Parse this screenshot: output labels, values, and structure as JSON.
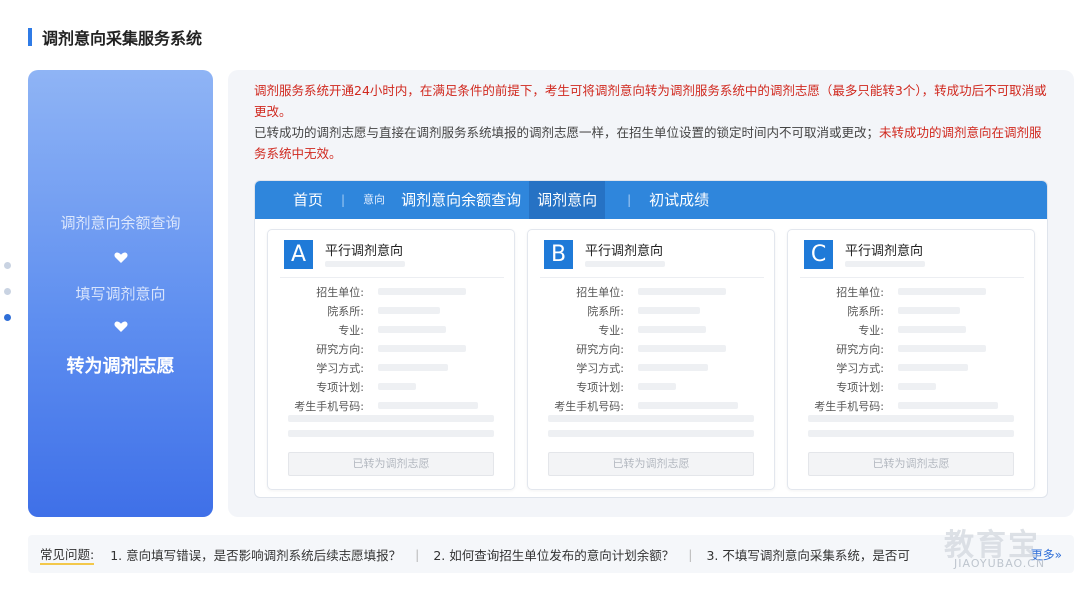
{
  "page": {
    "title": "调剂意向采集服务系统"
  },
  "steps": [
    {
      "label": "调剂意向余额查询"
    },
    {
      "label": "填写调剂意向"
    },
    {
      "label": "转为调剂志愿"
    }
  ],
  "notice": {
    "p1": "调剂服务系统开通24小时内，在满足条件的前提下，考生可将调剂意向转为调剂服务系统中的调剂志愿（最多只能转3个），转成功后不可取消或更改。",
    "p2_gray": "已转成功的调剂志愿与直接在调剂服务系统填报的调剂志愿一样，在招生单位设置的锁定时间内不可取消或更改；",
    "p2_red": "未转成功的调剂意向在调剂服务系统中无效。"
  },
  "nav": {
    "home": "首页",
    "small": "意向",
    "balance": "调剂意向余额查询",
    "intent": "调剂意向",
    "exam": "初试成绩",
    "sep": "|"
  },
  "card_common": {
    "title": "平行调剂意向",
    "fields": [
      "招生单位:",
      "院系所:",
      "专业:",
      "研究方向:",
      "学习方式:",
      "专项计划:",
      "考生手机号码:"
    ],
    "button": "已转为调剂志愿"
  },
  "cards": [
    {
      "letter": "A"
    },
    {
      "letter": "B"
    },
    {
      "letter": "C"
    }
  ],
  "faq": {
    "label": "常见问题:",
    "items": [
      "1. 意向填写错误，是否影响调剂系统后续志愿填报？",
      "2. 如何查询招生单位发布的意向计划余额？",
      "3. 不填写调剂意向采集系统，是否可"
    ],
    "more": "更多»"
  },
  "watermark": {
    "main": "教育宝",
    "sub": "JIAOYUBAO.CN"
  },
  "colors": {
    "accent": "#2f86dc",
    "red": "#d0281e",
    "panel_gradient_top": "#8fb4f5",
    "panel_gradient_bottom": "#3f70e8"
  }
}
